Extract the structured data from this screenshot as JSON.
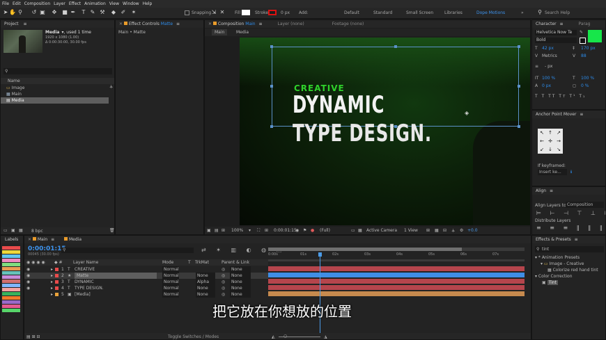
{
  "menu": [
    "File",
    "Edit",
    "Composition",
    "Layer",
    "Effect",
    "Animation",
    "View",
    "Window",
    "Help"
  ],
  "toolbar": {
    "snapping": "Snapping",
    "fill": "Fill",
    "stroke": "Stroke",
    "stroke_width": "0 px",
    "add": "Add:",
    "workspaces": [
      "Default",
      "Standard",
      "Small Screen",
      "Libraries"
    ],
    "active_workspace": "Dope Motions",
    "search_placeholder": "Search Help"
  },
  "project": {
    "title": "Project",
    "item_name": "Media",
    "item_used": ", used 1 time",
    "item_size": "1920 x 1080 (1.00)",
    "item_duration": "Δ 0:00:30:00, 30.00 fps",
    "name_header": "Name",
    "items": [
      {
        "label": "Image",
        "kind": "folder"
      },
      {
        "label": "Main",
        "kind": "comp"
      },
      {
        "label": "Media",
        "kind": "footage"
      }
    ],
    "bpc": "8 bpc"
  },
  "effect_controls": {
    "title": "Effect Controls",
    "layer": "Matte",
    "breadcrumb": "Main • Matte"
  },
  "composition": {
    "title": "Composition",
    "comp_name": "Main",
    "layer_tab": "Layer (none)",
    "footage_tab": "Footage (none)",
    "nav": [
      "Main",
      "Media"
    ],
    "text_line1": "CREATIVE",
    "text_line2": "DYNAMIC",
    "text_line3": "TYPE DESIGN.",
    "zoom": "100%",
    "timecode": "0:00:01:15",
    "resolution": "(Full)",
    "camera": "Active Camera",
    "view": "1 View",
    "exposure": "+0.0"
  },
  "character": {
    "title": "Character",
    "title2": "Parag",
    "font": "Helvetica Now Te",
    "style": "Bold",
    "size": "42 px",
    "leading": "170 px",
    "kerning": "Metrics",
    "tracking": "88",
    "stroke": "- px",
    "vscale": "100 %",
    "hscale": "100 %",
    "baseline": "0 px",
    "tsume": "0 %",
    "fill_color": "#17e64a"
  },
  "anchor": {
    "title": "Anchor Point Mover",
    "if_keyframed": "If keyframed:",
    "option": "Insert ke..."
  },
  "align": {
    "title": "Align",
    "align_to_label": "Align Layers to:",
    "align_to_value": "Composition",
    "distribute": "Distribute Layers"
  },
  "effects": {
    "title": "Effects & Presets",
    "search": "tint",
    "tree": [
      "* Animation Presets",
      "Image - Creative",
      "Colorize red hand tint",
      "Color Correction",
      "Tint"
    ]
  },
  "labels": {
    "title": "Labels",
    "colors": [
      "#e94b4b",
      "#eed63a",
      "#60c4ef",
      "#ef89c0",
      "#7fdc7f",
      "#e99b52",
      "#66c2b9",
      "#c98bd9",
      "#cf6e6e",
      "#7fb6ff",
      "#f4a2a2",
      "#39b35c",
      "#f07a2a",
      "#9b69c9",
      "#e55a8f",
      "#57d66a"
    ]
  },
  "timeline": {
    "tabs": [
      "Main",
      "Media"
    ],
    "timecode": "0:00:01:15",
    "fps_info": "00045 (30.00 fps)",
    "columns": {
      "layer_name": "Layer Name",
      "mode": "Mode",
      "t": "T",
      "trkmat": "TrkMat",
      "parent": "Parent & Link"
    },
    "ruler": [
      "0:00s",
      "01s",
      "02s",
      "03s",
      "04s",
      "05s",
      "06s",
      "07s"
    ],
    "layers": [
      {
        "num": "1",
        "type": "T",
        "name": "CREATIVE",
        "mode": "Normal",
        "trkmat": "",
        "parent": "None",
        "color": "#e94b4b",
        "bar": "#b5454c"
      },
      {
        "num": "2",
        "type": "★",
        "name": "Matte",
        "mode": "Normal",
        "trkmat": "None",
        "parent": "None",
        "color": "#e94b4b",
        "bar": "#3f8ee6"
      },
      {
        "num": "3",
        "type": "T",
        "name": "DYNAMIC",
        "mode": "Normal",
        "trkmat": "Alpha",
        "parent": "None",
        "color": "#e94b4b",
        "bar": "#b5454c"
      },
      {
        "num": "4",
        "type": "T",
        "name": "TYPE DESIGN.",
        "mode": "Normal",
        "trkmat": "None",
        "parent": "None",
        "color": "#e94b4b",
        "bar": "#b5454c"
      },
      {
        "num": "5",
        "type": "▣",
        "name": "[Media]",
        "mode": "Normal",
        "trkmat": "None",
        "parent": "None",
        "color": "#e9a23a",
        "bar": "#c68a4e"
      }
    ],
    "toggle": "Toggle Switches / Modes",
    "playhead_fraction": 0.2
  },
  "subtitle": "把它放在你想放的位置"
}
